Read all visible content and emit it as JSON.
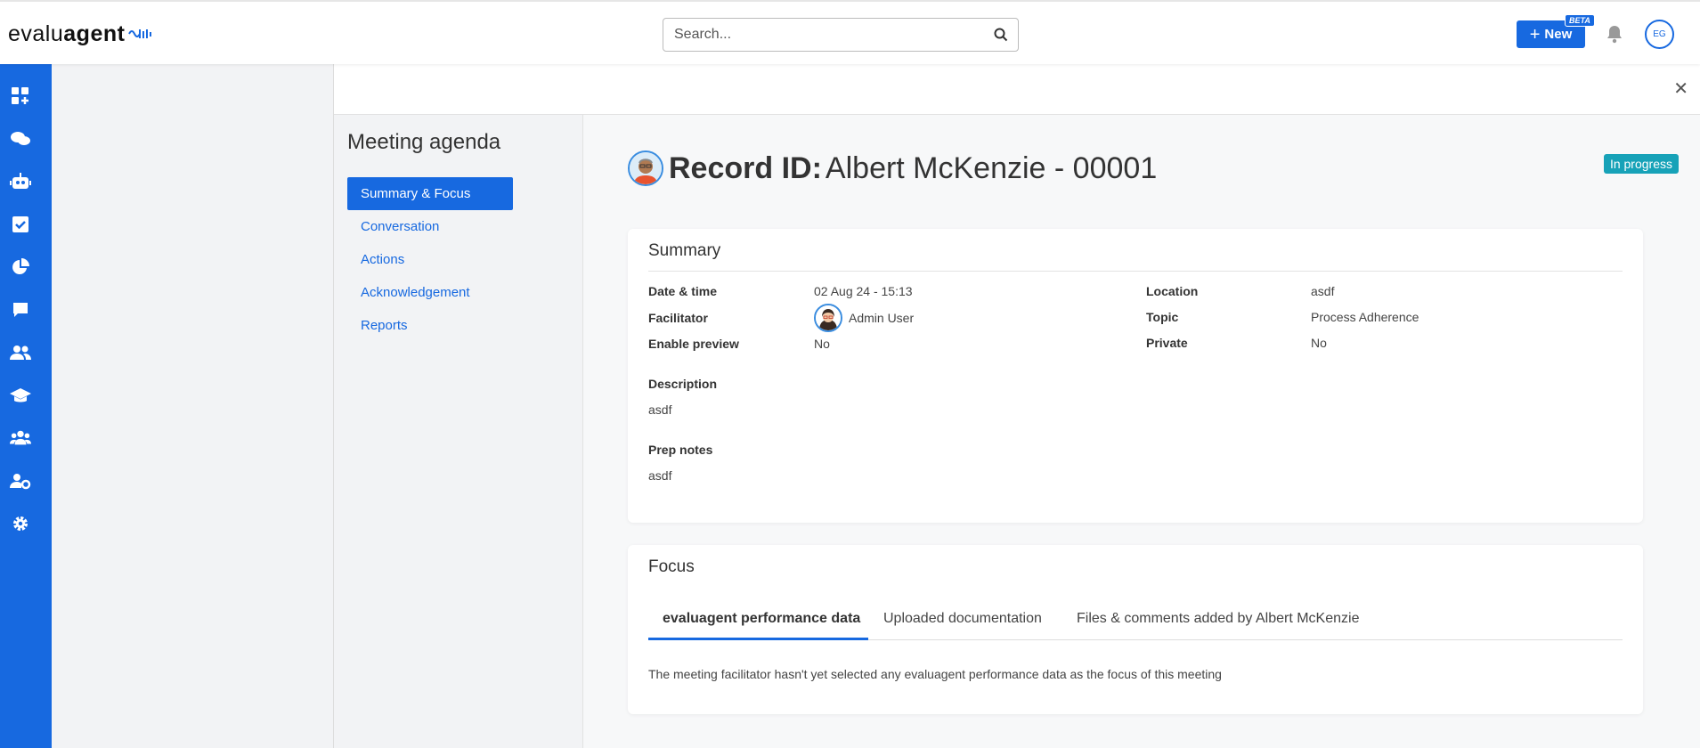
{
  "app": {
    "logo_text_light": "evalu",
    "logo_text_bold": "agent",
    "search_placeholder": "Search...",
    "new_label": "New",
    "beta_label": "BETA",
    "user_initials": "EG"
  },
  "agenda": {
    "title": "Meeting agenda",
    "items": [
      "Summary & Focus",
      "Conversation",
      "Actions",
      "Acknowledgement",
      "Reports"
    ]
  },
  "record": {
    "label": "Record ID:",
    "value": "Albert McKenzie - 00001",
    "status": "In progress"
  },
  "summary": {
    "title": "Summary",
    "date_label": "Date & time",
    "date_value": "02 Aug 24 - 15:13",
    "facilitator_label": "Facilitator",
    "facilitator_value": "Admin User",
    "preview_label": "Enable preview",
    "preview_value": "No",
    "location_label": "Location",
    "location_value": "asdf",
    "topic_label": "Topic",
    "topic_value": "Process Adherence",
    "private_label": "Private",
    "private_value": "No",
    "description_label": "Description",
    "description_value": "asdf",
    "prep_label": "Prep notes",
    "prep_value": "asdf"
  },
  "focus": {
    "title": "Focus",
    "tabs": [
      "evaluagent performance data",
      "Uploaded documentation",
      "Files & comments added by Albert McKenzie"
    ],
    "message": "The meeting facilitator hasn't yet selected any evaluagent performance data as the focus of this meeting"
  },
  "colors": {
    "primary": "#1769e0",
    "status": "#17a2b8"
  },
  "icons": [
    "dashboard-icon",
    "conversations-icon",
    "robot-icon",
    "check-icon",
    "pie-chart-icon",
    "comment-icon",
    "users-icon",
    "graduation-icon",
    "team-icon",
    "user-settings-icon",
    "gear-icon"
  ]
}
